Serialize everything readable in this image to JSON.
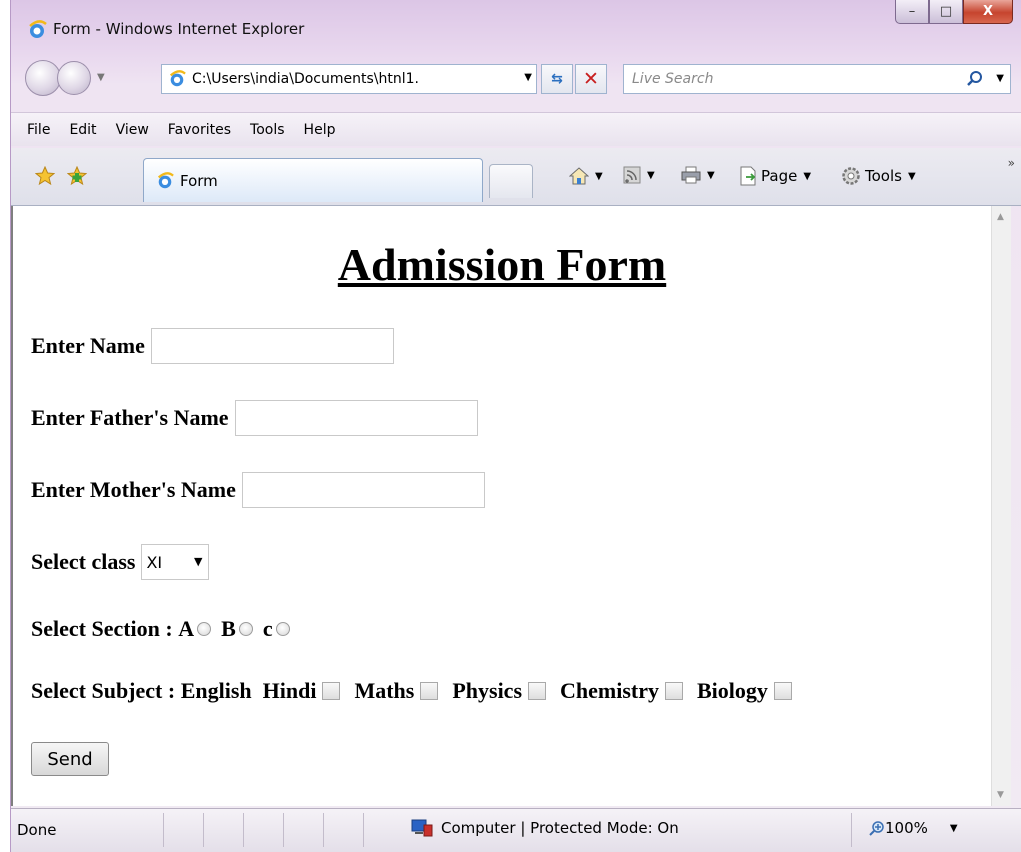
{
  "window": {
    "title": "Form - Windows Internet Explorer",
    "minimize_glyph": "–",
    "maximize_glyph": "□",
    "close_glyph": "X"
  },
  "nav": {
    "address": "C:\\Users\\india\\Documents\\htnl1.",
    "search_placeholder": "Live Search"
  },
  "menu": {
    "items": [
      "File",
      "Edit",
      "View",
      "Favorites",
      "Tools",
      "Help"
    ]
  },
  "toolbar": {
    "tab_title": "Form",
    "page_label": "Page",
    "tools_label": "Tools"
  },
  "form": {
    "heading": "Admission Form",
    "name_label": "Enter Name",
    "name_value": "",
    "father_label": "Enter Father's Name",
    "father_value": "",
    "mother_label": "Enter Mother's Name",
    "mother_value": "",
    "class_label": "Select class",
    "class_selected": "XI",
    "section_label": "Select Section :",
    "sections": [
      "A",
      "B",
      "c"
    ],
    "subject_label": "Select Subject :",
    "subjects": [
      "English",
      "Hindi",
      "Maths",
      "Physics",
      "Chemistry",
      "Biology"
    ],
    "send_label": "Send"
  },
  "status": {
    "text": "Done",
    "zone": "Computer | Protected Mode: On",
    "zoom": "100%"
  },
  "colors": {
    "title_bar": "#dcc6e6",
    "close_button": "#c6442e",
    "address_border": "#9fb3cf"
  }
}
